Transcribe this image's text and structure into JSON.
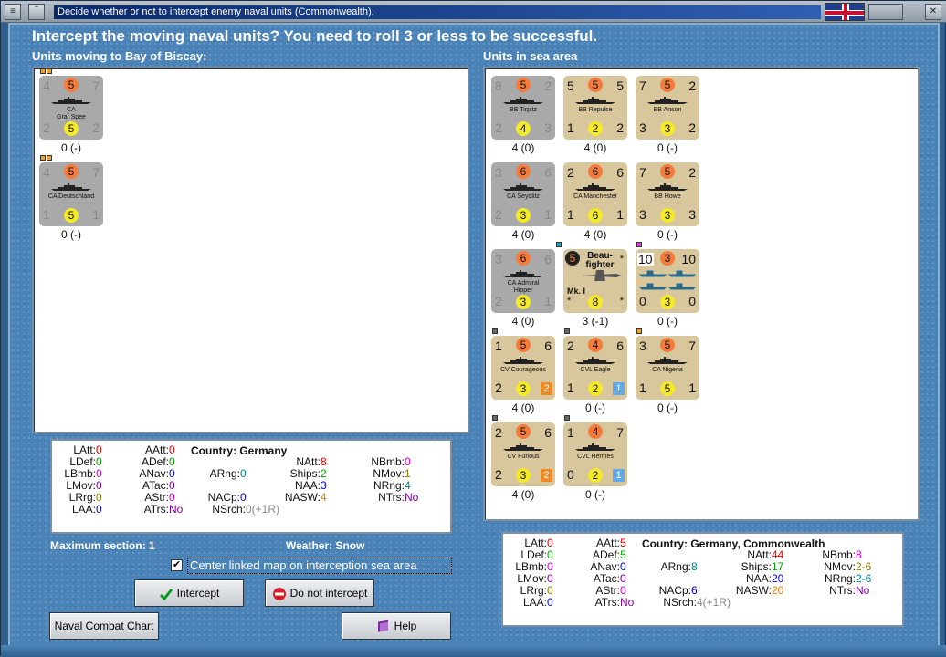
{
  "window": {
    "title": "Decide whether or not to intercept enemy naval units (Commonwealth)."
  },
  "headline": "Intercept the moving naval units?  You need to roll 3 or less to be successful.",
  "left_label": "Units moving to Bay of Biscay:",
  "right_label": "Units in sea area",
  "left_units": [
    {
      "tl": "4",
      "top": "5",
      "tr": "7",
      "name": "CA\nGraf Spee",
      "bl": "2",
      "bot": "5",
      "br": "2",
      "under": "0 (-)",
      "color": "gray"
    },
    {
      "tl": "4",
      "top": "5",
      "tr": "7",
      "name": "CA Deutschland",
      "bl": "1",
      "bot": "5",
      "br": "1",
      "under": "0 (-)",
      "color": "gray"
    }
  ],
  "right_units": [
    {
      "tl": "8",
      "top": "5",
      "tr": "2",
      "name": "BB Tirpitz",
      "bl": "2",
      "bot": "4",
      "br": "3",
      "under": "4 (0)",
      "color": "gray"
    },
    {
      "tl": "5",
      "top": "5",
      "tr": "5",
      "name": "BB Repulse",
      "bl": "1",
      "bot": "2",
      "br": "2",
      "under": "4 (0)",
      "color": "tan"
    },
    {
      "tl": "7",
      "top": "5",
      "tr": "2",
      "name": "BB Anson",
      "bl": "3",
      "bot": "3",
      "br": "2",
      "under": "0 (-)",
      "color": "tan"
    },
    {
      "tl": "3",
      "top": "6",
      "tr": "6",
      "name": "CA Seydlitz",
      "bl": "2",
      "bot": "3",
      "br": "1",
      "under": "4 (0)",
      "color": "gray"
    },
    {
      "tl": "2",
      "top": "6",
      "tr": "6",
      "name": "CA Manchester",
      "bl": "1",
      "bot": "6",
      "br": "1",
      "under": "4 (0)",
      "color": "tan"
    },
    {
      "tl": "7",
      "top": "5",
      "tr": "2",
      "name": "BB Howe",
      "bl": "3",
      "bot": "3",
      "br": "3",
      "under": "0 (-)",
      "color": "tan"
    },
    {
      "tl": "3",
      "top": "6",
      "tr": "6",
      "name": "CA Admiral\nHipper",
      "bl": "2",
      "bot": "3",
      "br": "1",
      "under": "4 (0)",
      "color": "gray"
    },
    {
      "tl": "5",
      "top": "Beau-\nfighter",
      "tr": "*",
      "name": "Mk. I",
      "bl": "*",
      "bot": "8",
      "br": "*",
      "under": "3 (-1)",
      "color": "tan",
      "kind": "air"
    },
    {
      "tl": "10",
      "top": "3",
      "tr": "10",
      "name": "",
      "bl": "0",
      "bot": "3",
      "br": "0",
      "under": "0 (-)",
      "color": "tan",
      "kind": "convoy"
    },
    {
      "tl": "1",
      "top": "5",
      "tr": "6",
      "name": "CV Courageous",
      "bl": "2",
      "bot": "3",
      "br": "",
      "sq": "2",
      "sqc": "orange",
      "under": "4 (0)",
      "color": "tan"
    },
    {
      "tl": "2",
      "top": "4",
      "tr": "6",
      "name": "CVL Eagle",
      "bl": "1",
      "bot": "2",
      "br": "",
      "sq": "1",
      "sqc": "blue",
      "under": "0 (-)",
      "color": "tan"
    },
    {
      "tl": "3",
      "top": "5",
      "tr": "7",
      "name": "CA Nigeria",
      "bl": "1",
      "bot": "5",
      "br": "1",
      "under": "0 (-)",
      "color": "tan"
    },
    {
      "tl": "2",
      "top": "5",
      "tr": "6",
      "name": "CV Furious",
      "bl": "2",
      "bot": "3",
      "br": "",
      "sq": "2",
      "sqc": "orange",
      "under": "4 (0)",
      "color": "tan"
    },
    {
      "tl": "1",
      "top": "4",
      "tr": "7",
      "name": "CVL Hermes",
      "bl": "0",
      "bot": "2",
      "br": "",
      "sq": "1",
      "sqc": "blue",
      "under": "0 (-)",
      "color": "tan"
    }
  ],
  "stats_left": {
    "country": "Country: Germany",
    "LAtt": "0",
    "LDef": "0",
    "LBmb": "0",
    "LMov": "0",
    "LRrg": "0",
    "LAA": "0",
    "AAtt": "0",
    "ADef": "0",
    "ANav": "0",
    "ATac": "0",
    "AStr": "0",
    "ATrs": "No",
    "ARng": "0",
    "NACp": "0",
    "NSrch": "0(+1R)",
    "NAtt": "8",
    "Ships": "2",
    "NAA": "3",
    "NASW": "4",
    "NBmb": "0",
    "NMov": "1",
    "NRng": "4",
    "NTrs": "No"
  },
  "stats_right": {
    "country": "Country: Germany, Commonwealth",
    "LAtt": "0",
    "LDef": "0",
    "LBmb": "0",
    "LMov": "0",
    "LRrg": "0",
    "LAA": "0",
    "AAtt": "5",
    "ADef": "5",
    "ANav": "0",
    "ATac": "0",
    "AStr": "0",
    "ATrs": "No",
    "ARng": "8",
    "NACp": "6",
    "NSrch": "4(+1R)",
    "NAtt": "44",
    "Ships": "17",
    "NAA": "20",
    "NASW": "20",
    "NBmb": "8",
    "NMov": "2-6",
    "NRng": "2-6",
    "NTrs": "No"
  },
  "footer": {
    "max_section": "Maximum section: 1",
    "weather": "Weather:  Snow",
    "center_label": "Center linked map on interception sea area",
    "intercept": "Intercept",
    "no_intercept": "Do not intercept",
    "chart": "Naval Combat Chart",
    "help": "Help"
  }
}
